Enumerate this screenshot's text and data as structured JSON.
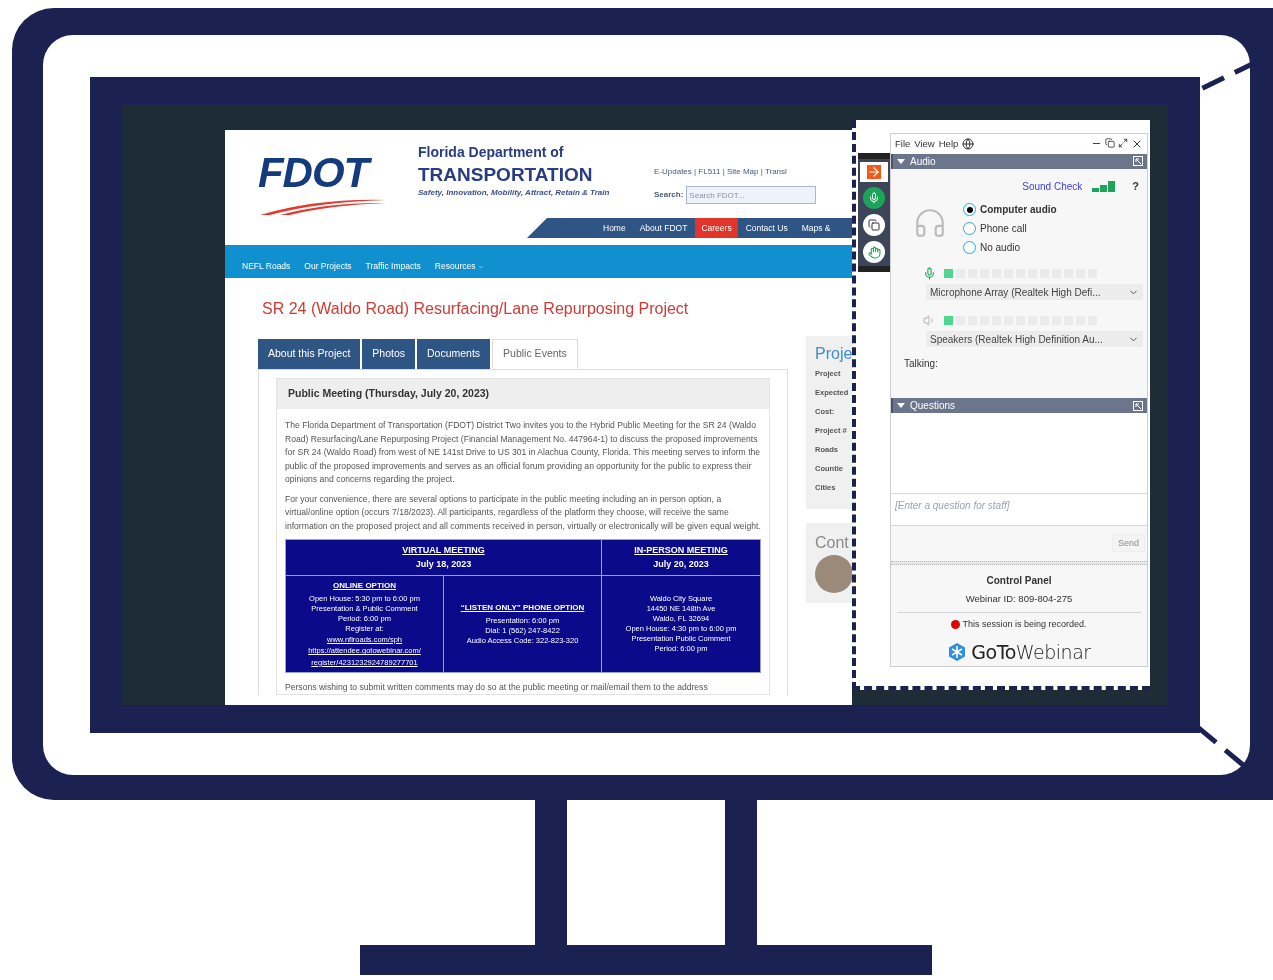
{
  "webpage": {
    "logo_text": "FDOT",
    "agency_name": "Florida Department of",
    "agency_title": "TRANSPORTATION",
    "tagline": "Safety, Innovation, Mobility, Attract, Retain & Train",
    "utility_links": "E-Updates | FL511 | Site Map | Transl",
    "search": {
      "label": "Search:",
      "placeholder": "Search FDOT..."
    },
    "top_nav": [
      {
        "label": "Home",
        "selected": false
      },
      {
        "label": "About FDOT",
        "selected": false
      },
      {
        "label": "Careers",
        "selected": true
      },
      {
        "label": "Contact Us",
        "selected": false
      },
      {
        "label": "Maps &",
        "selected": false
      }
    ],
    "sub_nav": [
      {
        "label": "NEFL Roads",
        "dropdown": false
      },
      {
        "label": "Our Projects",
        "dropdown": false
      },
      {
        "label": "Traffic Impacts",
        "dropdown": false
      },
      {
        "label": "Resources",
        "dropdown": true
      }
    ],
    "page_title": "SR 24 (Waldo Road) Resurfacing/Lane Repurposing Project",
    "tabs": [
      {
        "label": "About this Project",
        "selected": false
      },
      {
        "label": "Photos",
        "selected": false
      },
      {
        "label": "Documents",
        "selected": false
      },
      {
        "label": "Public Events",
        "selected": true
      }
    ],
    "event": {
      "heading": "Public Meeting (Thursday, July 20, 2023)",
      "paragraphs": [
        "The Florida Department of Transportation (FDOT) District Two invites you to the Hybrid Public Meeting for the SR 24 (Waldo Road) Resurfacing/Lane Repurposing Project (Financial Management No. 447964-1) to discuss the proposed improvements for SR 24 (Waldo Road) from west of NE 141st Drive to US 301 in Alachua County, Florida. This meeting serves to inform the public of the proposed improvements and serves as an official forum providing an opportunity for the public to express their opinions and concerns regarding the project.",
        "For your convenience, there are several options to participate in the public meeting including an in person option, a virtual/online option (occurs 7/18/2023). All participants, regardless of the platform they choose, will receive the same information on the proposed project and all comments received in person, virtually or electronically will be given equal weight."
      ],
      "table": {
        "header": [
          {
            "title": "VIRTUAL MEETING",
            "date": "July 18, 2023"
          },
          {
            "title": "IN-PERSON MEETING",
            "date": "July 20, 2023"
          }
        ],
        "cells": [
          {
            "lines": [
              {
                "kind": "heading",
                "text": "ONLINE OPTION"
              },
              {
                "kind": "text",
                "text": "Open House: 5:30 pm to 6:00 pm"
              },
              {
                "kind": "text",
                "text": "Presentation & Public Comment"
              },
              {
                "kind": "text",
                "text": "Period: 6:00 pm"
              },
              {
                "kind": "text",
                "text": "Register at:"
              },
              {
                "kind": "link",
                "text": "www.nflroads.com/sph"
              },
              {
                "kind": "link",
                "text": "https://attendee.gotowebinar.com/"
              },
              {
                "kind": "link",
                "text": "register/4231232924789277701"
              }
            ]
          },
          {
            "lines": [
              {
                "kind": "heading",
                "text": "“LISTEN ONLY” PHONE OPTION"
              },
              {
                "kind": "text",
                "text": "Presentation: 6:00 pm"
              },
              {
                "kind": "text",
                "text": "Dial: 1 (562) 247-8422"
              },
              {
                "kind": "text",
                "text": "Audio Access Code: 322-823-320"
              }
            ]
          },
          {
            "lines": [
              {
                "kind": "text",
                "text": "Waldo City Square"
              },
              {
                "kind": "text",
                "text": "14450 NE 148th Ave"
              },
              {
                "kind": "text",
                "text": "Waldo, FL 32694"
              },
              {
                "kind": "text",
                "text": "Open House: 4:30 pm to 6:00 pm"
              },
              {
                "kind": "text",
                "text": "Presentation Public Comment"
              },
              {
                "kind": "text",
                "text": "Period: 6:00 pm"
              }
            ]
          }
        ]
      },
      "footer_text": "Persons wishing to submit written comments may do so at the public meeting or mail/email them to the address"
    },
    "sidebar": {
      "title": "Proje",
      "labels": [
        "Project",
        "Expected",
        "Cost:",
        "Project #",
        "Roads",
        "Countie",
        "Cities"
      ],
      "contact_title": "Cont"
    }
  },
  "webinar": {
    "menu": [
      "File",
      "View",
      "Help"
    ],
    "audio": {
      "title": "Audio",
      "expanded": true,
      "sound_check": "Sound Check",
      "help": "?",
      "options": [
        {
          "label": "Computer audio",
          "selected": true
        },
        {
          "label": "Phone call",
          "selected": false
        },
        {
          "label": "No audio",
          "selected": false
        }
      ],
      "mic": {
        "level": 0.08,
        "device": "Microphone Array (Realtek High Defi..."
      },
      "speaker": {
        "level": 0.08,
        "device": "Speakers (Realtek High Definition Au..."
      },
      "talking_label": "Talking:"
    },
    "questions": {
      "title": "Questions",
      "expanded": true,
      "placeholder": "[Enter a question for staff]",
      "send": {
        "label": "Send",
        "disabled": true
      }
    },
    "footer": {
      "title": "Control Panel",
      "webinar_id": "Webinar ID: 809-804-275",
      "recording": true,
      "recording_text": "This session is being recorded.",
      "brand": "**GoTo**Webinar"
    }
  }
}
